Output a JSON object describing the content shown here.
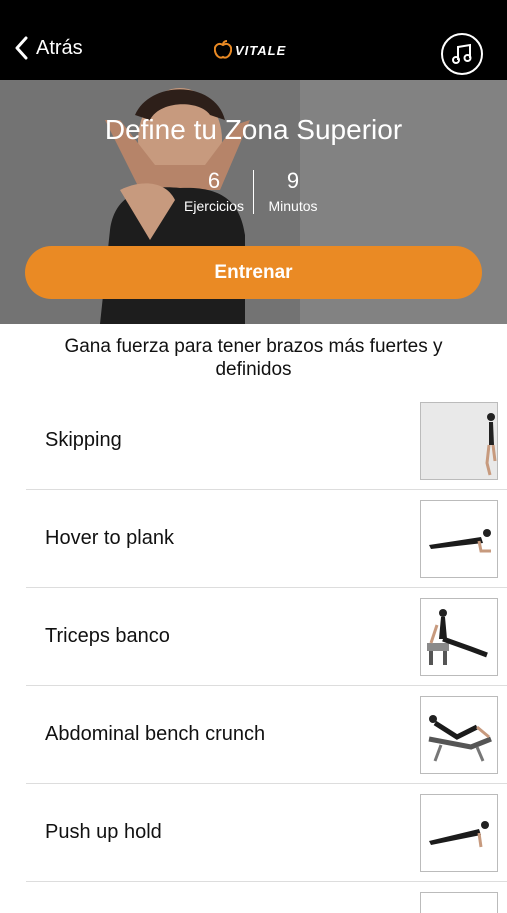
{
  "header": {
    "back_label": "Atrás",
    "logo_text": "VITALE"
  },
  "hero": {
    "title": "Define tu Zona Superior",
    "stats": [
      {
        "value": "6",
        "label": "Ejercicios"
      },
      {
        "value": "9",
        "label": "Minutos"
      }
    ],
    "train_button": "Entrenar"
  },
  "description": "Gana fuerza para tener brazos más fuertes y definidos",
  "exercises": [
    {
      "name": "Skipping",
      "icon": "skipping-thumbnail"
    },
    {
      "name": "Hover to plank",
      "icon": "plank-thumbnail"
    },
    {
      "name": "Triceps banco",
      "icon": "triceps-bench-thumbnail"
    },
    {
      "name": "Abdominal bench crunch",
      "icon": "bench-crunch-thumbnail"
    },
    {
      "name": "Push up hold",
      "icon": "push-up-thumbnail"
    }
  ],
  "colors": {
    "accent": "#ea8a24",
    "topbar": "#000000"
  }
}
